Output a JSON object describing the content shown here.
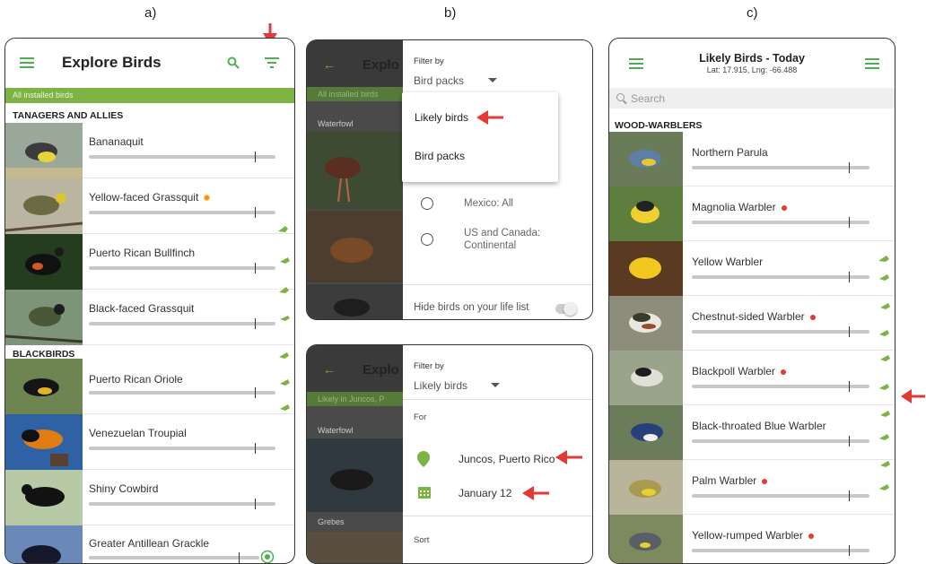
{
  "labels": {
    "a": "a)",
    "b": "b)",
    "c": "c)"
  },
  "panelA": {
    "title": "Explore Birds",
    "strip_left": "All installed birds",
    "strip_right": "",
    "sections": [
      {
        "header": "TANAGERS AND ALLIES",
        "birds": [
          "Bananaquit",
          "Yellow-faced Grassquit",
          "Puerto Rican Bullfinch",
          "Black-faced Grassquit"
        ]
      },
      {
        "header": "BLACKBIRDS",
        "birds": [
          "Puerto Rican Oriole",
          "Venezuelan Troupial",
          "Shiny Cowbird",
          "Greater Antillean Grackle"
        ]
      }
    ]
  },
  "panelB1": {
    "back_title": "Explo",
    "dim_strip": "All installed birds",
    "dim_section": "Waterfowl",
    "filter_by": "Filter by",
    "filter_value": "Bird packs",
    "dropdown": [
      "Likely birds",
      "Bird packs"
    ],
    "radios": [
      "Mexico: All",
      "US and Canada: Continental"
    ],
    "hide_label": "Hide birds on your life list"
  },
  "panelB2": {
    "back_title": "Explo",
    "dim_strip": "Likely in Juncos, P",
    "dim_sections": [
      "Waterfowl",
      "Grebes"
    ],
    "filter_by": "Filter by",
    "filter_value": "Likely birds",
    "for_label": "For",
    "location": "Juncos, Puerto Rico",
    "date": "January 12",
    "sort_label": "Sort"
  },
  "panelC": {
    "title": "Likely Birds - Today",
    "subtitle": "Lat: 17.915, Lng: -66.488",
    "search_placeholder": "Search",
    "section": "WOOD-WARBLERS",
    "birds": [
      "Northern Parula",
      "Magnolia Warbler",
      "Yellow Warbler",
      "Chestnut-sided Warbler",
      "Blackpoll Warbler",
      "Black-throated Blue Warbler",
      "Palm Warbler",
      "Yellow-rumped Warbler"
    ]
  },
  "colors": {
    "accent": "#4caf50",
    "strip": "#7cb342",
    "arrow": "#e53935"
  }
}
